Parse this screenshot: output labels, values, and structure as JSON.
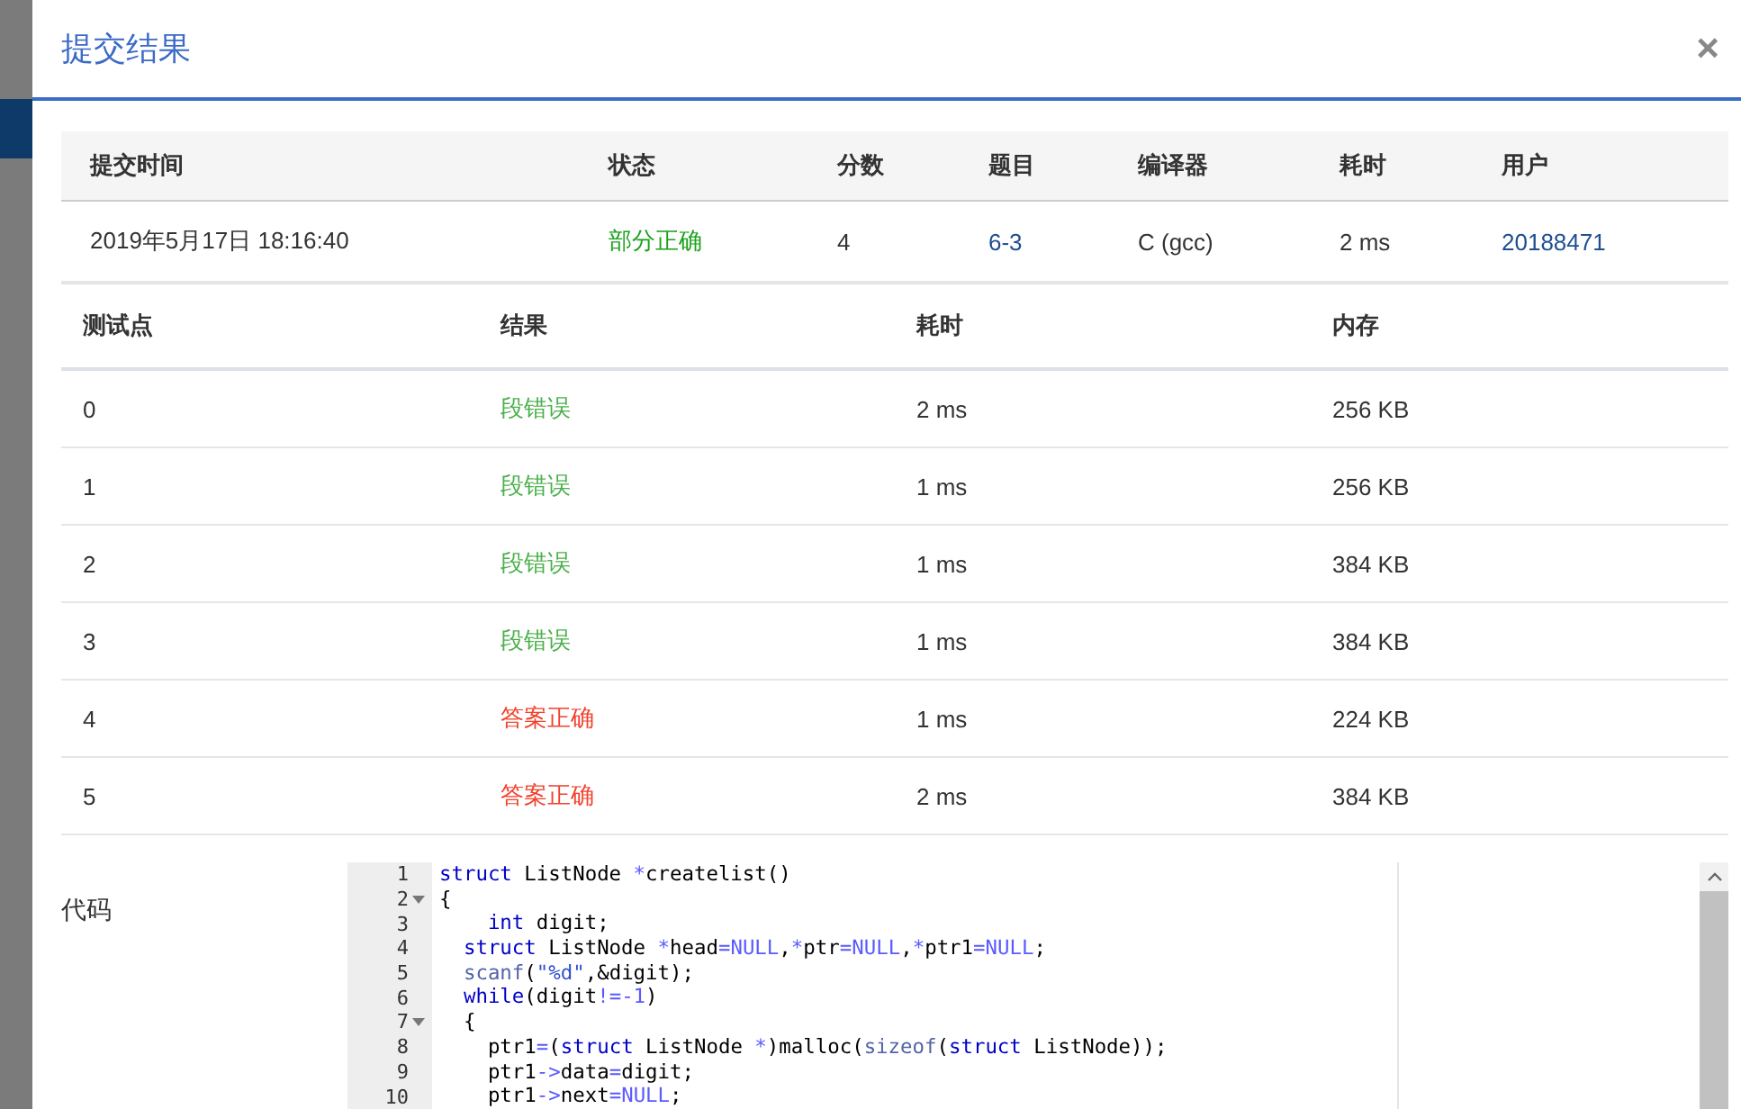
{
  "dialog": {
    "title": "提交结果",
    "close": "×"
  },
  "summary": {
    "columns": [
      "提交时间",
      "状态",
      "分数",
      "题目",
      "编译器",
      "耗时",
      "用户"
    ],
    "row": {
      "time": "2019年5月17日 18:16:40",
      "status": {
        "text": "部分正确",
        "kind": "partial"
      },
      "score": "4",
      "problem": "6-3",
      "compiler": "C (gcc)",
      "duration": "2 ms",
      "user": "20188471"
    }
  },
  "tests": {
    "columns": [
      "测试点",
      "结果",
      "耗时",
      "内存"
    ],
    "rows": [
      {
        "id": "0",
        "result": "段错误",
        "color": "#4cb04c",
        "time": "2 ms",
        "memory": "256 KB"
      },
      {
        "id": "1",
        "result": "段错误",
        "color": "#4cb04c",
        "time": "1 ms",
        "memory": "256 KB"
      },
      {
        "id": "2",
        "result": "段错误",
        "color": "#4cb04c",
        "time": "1 ms",
        "memory": "384 KB"
      },
      {
        "id": "3",
        "result": "段错误",
        "color": "#4cb04c",
        "time": "1 ms",
        "memory": "384 KB"
      },
      {
        "id": "4",
        "result": "答案正确",
        "color": "#f2412c",
        "time": "1 ms",
        "memory": "224 KB"
      },
      {
        "id": "5",
        "result": "答案正确",
        "color": "#f2412c",
        "time": "2 ms",
        "memory": "384 KB"
      }
    ]
  },
  "code": {
    "label": "代码",
    "lines": [
      {
        "number": "1",
        "foldable": false,
        "tokens": [
          {
            "kind": "kw",
            "text": "struct"
          },
          {
            "kind": "pl",
            "text": " ListNode "
          },
          {
            "kind": "op",
            "text": "*"
          },
          {
            "kind": "pl",
            "text": "createlist()"
          }
        ]
      },
      {
        "number": "2",
        "foldable": true,
        "tokens": [
          {
            "kind": "pl",
            "text": "{"
          }
        ]
      },
      {
        "number": "3",
        "foldable": false,
        "tokens": [
          {
            "kind": "kw",
            "text": "    int"
          },
          {
            "kind": "pl",
            "text": " digit;"
          }
        ]
      },
      {
        "number": "4",
        "foldable": false,
        "tokens": [
          {
            "kind": "kw",
            "text": "  struct"
          },
          {
            "kind": "pl",
            "text": " ListNode "
          },
          {
            "kind": "op",
            "text": "*"
          },
          {
            "kind": "pl",
            "text": "head"
          },
          {
            "kind": "op",
            "text": "="
          },
          {
            "kind": "cn",
            "text": "NULL"
          },
          {
            "kind": "pl",
            "text": ","
          },
          {
            "kind": "op",
            "text": "*"
          },
          {
            "kind": "pl",
            "text": "ptr"
          },
          {
            "kind": "op",
            "text": "="
          },
          {
            "kind": "cn",
            "text": "NULL"
          },
          {
            "kind": "pl",
            "text": ","
          },
          {
            "kind": "op",
            "text": "*"
          },
          {
            "kind": "pl",
            "text": "ptr1"
          },
          {
            "kind": "op",
            "text": "="
          },
          {
            "kind": "cn",
            "text": "NULL"
          },
          {
            "kind": "pl",
            "text": ";"
          }
        ]
      },
      {
        "number": "5",
        "foldable": false,
        "tokens": [
          {
            "kind": "fn",
            "text": "  scanf"
          },
          {
            "kind": "pl",
            "text": "("
          },
          {
            "kind": "st",
            "text": "\"%d\""
          },
          {
            "kind": "pl",
            "text": ",&digit);"
          }
        ]
      },
      {
        "number": "6",
        "foldable": false,
        "tokens": [
          {
            "kind": "kw",
            "text": "  while"
          },
          {
            "kind": "pl",
            "text": "(digit"
          },
          {
            "kind": "op",
            "text": "!="
          },
          {
            "kind": "cn",
            "text": "-1"
          },
          {
            "kind": "pl",
            "text": ")"
          }
        ]
      },
      {
        "number": "7",
        "foldable": true,
        "tokens": [
          {
            "kind": "pl",
            "text": "  {"
          }
        ]
      },
      {
        "number": "8",
        "foldable": false,
        "tokens": [
          {
            "kind": "pl",
            "text": "    ptr1"
          },
          {
            "kind": "op",
            "text": "="
          },
          {
            "kind": "pl",
            "text": "("
          },
          {
            "kind": "kw",
            "text": "struct"
          },
          {
            "kind": "pl",
            "text": " ListNode "
          },
          {
            "kind": "op",
            "text": "*"
          },
          {
            "kind": "pl",
            "text": ")malloc("
          },
          {
            "kind": "fn",
            "text": "sizeof"
          },
          {
            "kind": "pl",
            "text": "("
          },
          {
            "kind": "kw",
            "text": "struct"
          },
          {
            "kind": "pl",
            "text": " ListNode));"
          }
        ]
      },
      {
        "number": "9",
        "foldable": false,
        "tokens": [
          {
            "kind": "pl",
            "text": "    ptr1"
          },
          {
            "kind": "op",
            "text": "->"
          },
          {
            "kind": "pl",
            "text": "data"
          },
          {
            "kind": "op",
            "text": "="
          },
          {
            "kind": "pl",
            "text": "digit;"
          }
        ]
      },
      {
        "number": "10",
        "foldable": false,
        "tokens": [
          {
            "kind": "pl",
            "text": "    ptr1"
          },
          {
            "kind": "op",
            "text": "->"
          },
          {
            "kind": "pl",
            "text": "next"
          },
          {
            "kind": "op",
            "text": "="
          },
          {
            "kind": "cn",
            "text": "NULL"
          },
          {
            "kind": "pl",
            "text": ";"
          }
        ]
      }
    ]
  }
}
